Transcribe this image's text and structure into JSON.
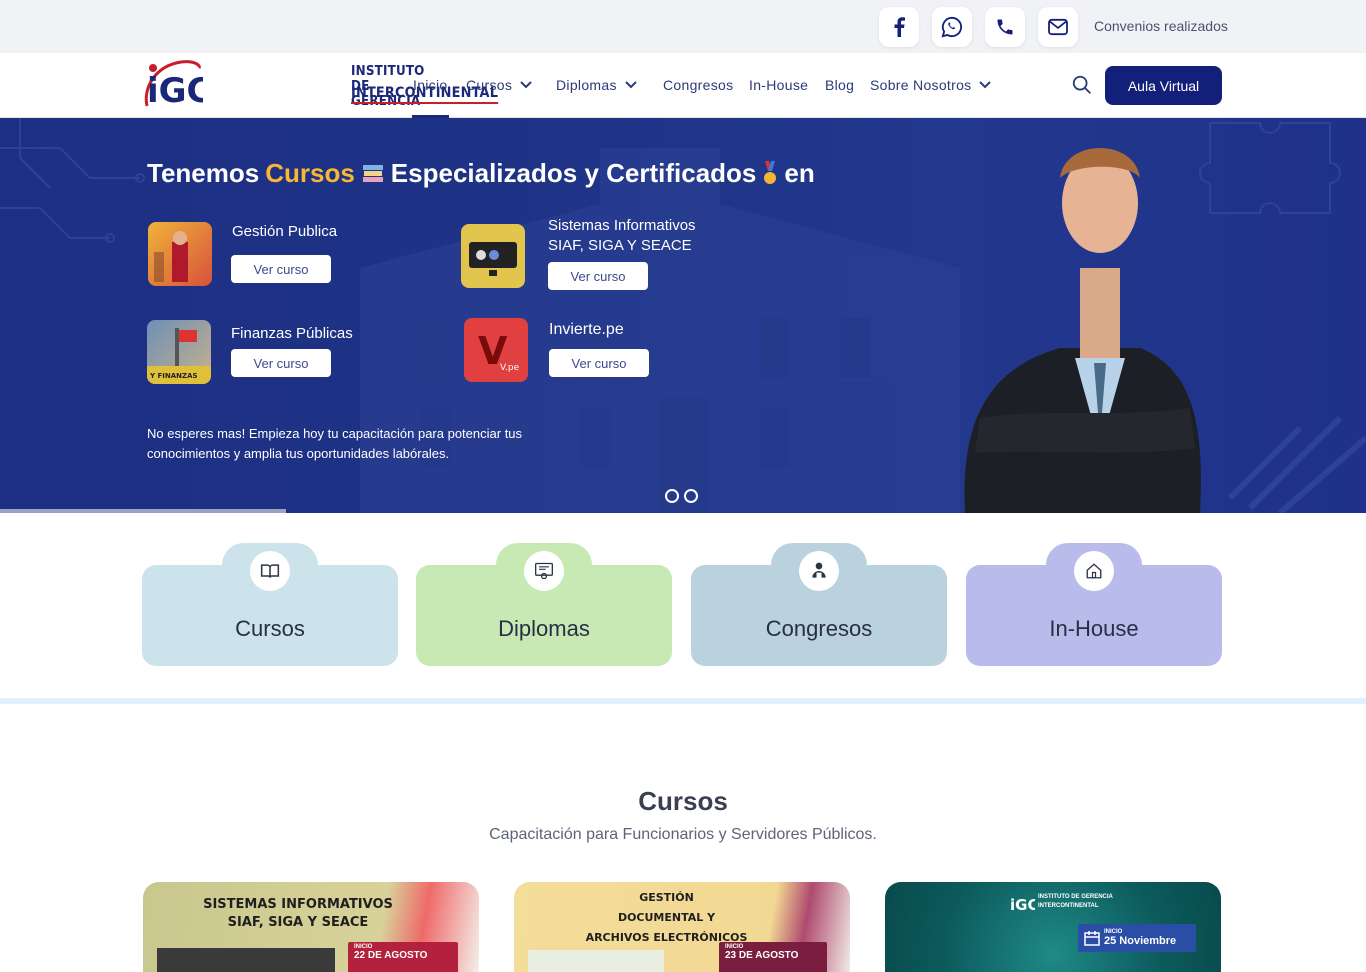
{
  "topbar": {
    "socials": [
      {
        "icon": "facebook-icon"
      },
      {
        "icon": "whatsapp-icon"
      },
      {
        "icon": "phone-icon"
      },
      {
        "icon": "mail-icon"
      }
    ],
    "convenios": "Convenios realizados"
  },
  "logo": {
    "mark": "iGC",
    "line1": "INSTITUTO DE GERENCIA",
    "line2": "INTERCONTINENTAL"
  },
  "nav": {
    "items": [
      {
        "label": "Inicio",
        "dropdown": false,
        "active": true
      },
      {
        "label": "Cursos",
        "dropdown": true
      },
      {
        "label": "Diplomas",
        "dropdown": true
      },
      {
        "label": "Congresos",
        "dropdown": false
      },
      {
        "label": "In-House",
        "dropdown": false
      },
      {
        "label": "Blog",
        "dropdown": false
      },
      {
        "label": "Sobre Nosotros",
        "dropdown": true
      }
    ],
    "aula": "Aula Virtual"
  },
  "hero": {
    "title_part1": "Tenemos",
    "title_accent": "Cursos",
    "title_part2": "Especializados y Certificados",
    "title_part3": "en",
    "courses": [
      {
        "name": "Gestión Publica",
        "button": "Ver curso"
      },
      {
        "name_line1": "Sistemas Informativos",
        "name_line2": "SIAF, SIGA Y SEACE",
        "button": "Ver curso"
      },
      {
        "name": "Finanzas Públicas",
        "button": "Ver curso"
      },
      {
        "name": "Invierte.pe",
        "button": "Ver curso"
      }
    ],
    "description": "No esperes mas! Empieza hoy tu capacitación para potenciar tus conocimientos y amplia tus oportunidades labórales.",
    "slide_count": 2,
    "thumb_label_finanzas": "Y FINANZAS",
    "thumb_label_invierte": "V.pe"
  },
  "categories": [
    {
      "label": "Cursos",
      "icon": "book-icon",
      "color": "#cde3eb"
    },
    {
      "label": "Diplomas",
      "icon": "certificate-icon",
      "color": "#c8e8b4"
    },
    {
      "label": "Congresos",
      "icon": "speaker-icon",
      "color": "#bad2dd"
    },
    {
      "label": "In-House",
      "icon": "home-icon",
      "color": "#b9bceb"
    }
  ],
  "section": {
    "title": "Cursos",
    "subtitle": "Capacitación para Funcionarios y Servidores Públicos."
  },
  "cards": [
    {
      "title_line1": "SISTEMAS INFORMATIVOS",
      "title_line2": "SIAF, SIGA Y SEACE",
      "badge_small": "INICIO",
      "badge": "22 DE AGOSTO"
    },
    {
      "title_line1": "GESTIÓN",
      "title_line2": "DOCUMENTAL Y",
      "title_line3": "ARCHIVOS ELECTRÓNICOS",
      "badge_small": "INICIO",
      "badge": "23 DE AGOSTO"
    },
    {
      "logo_line1": "INSTITUTO DE GERENCIA",
      "logo_line2": "INTERCONTINENTAL",
      "badge_small": "INICIO",
      "badge": "25 Noviembre"
    }
  ]
}
